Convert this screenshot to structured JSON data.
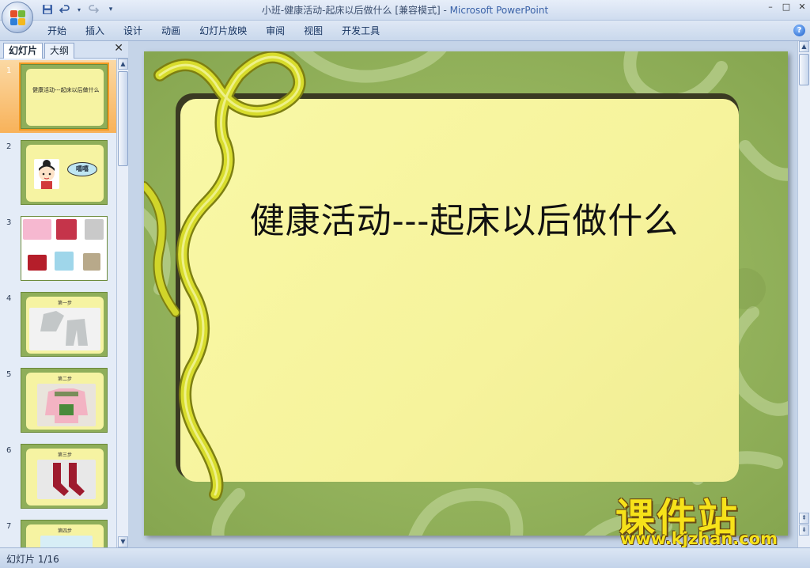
{
  "window": {
    "title_doc": "小班-健康活动-起床以后做什么 [兼容模式]",
    "title_sep": " - ",
    "title_app": "Microsoft PowerPoint",
    "controls": [
      "–",
      "□",
      "✕"
    ]
  },
  "quick_access": {
    "save_icon": "save-icon",
    "undo_icon": "undo-icon",
    "redo_icon": "redo-icon",
    "customize_icon": "customize-icon"
  },
  "ribbon": {
    "tabs": [
      "开始",
      "插入",
      "设计",
      "动画",
      "幻灯片放映",
      "审阅",
      "视图",
      "开发工具"
    ],
    "help_label": "?"
  },
  "left_pane": {
    "tabs": [
      "幻灯片",
      "大纲"
    ],
    "close_label": "✕",
    "thumbnails": [
      {
        "number": "1",
        "caption": "健康活动---起床以后做什么",
        "active": true
      },
      {
        "number": "2",
        "caption": "",
        "bubble": "嘻嘻"
      },
      {
        "number": "3",
        "caption": ""
      },
      {
        "number": "4",
        "caption": "第一步"
      },
      {
        "number": "5",
        "caption": "第二步"
      },
      {
        "number": "6",
        "caption": "第三步"
      },
      {
        "number": "7",
        "caption": "第四步"
      }
    ]
  },
  "slide": {
    "title": "健康活动---起床以后做什么",
    "colors": {
      "background": "#92b25d",
      "frame": "#f6f39c",
      "ribbon": "#c9cc1e"
    }
  },
  "watermark": {
    "big_text": "课件站",
    "url": "www.kjzhan.com"
  },
  "status": {
    "slide_counter": "幻灯片 1/16"
  }
}
